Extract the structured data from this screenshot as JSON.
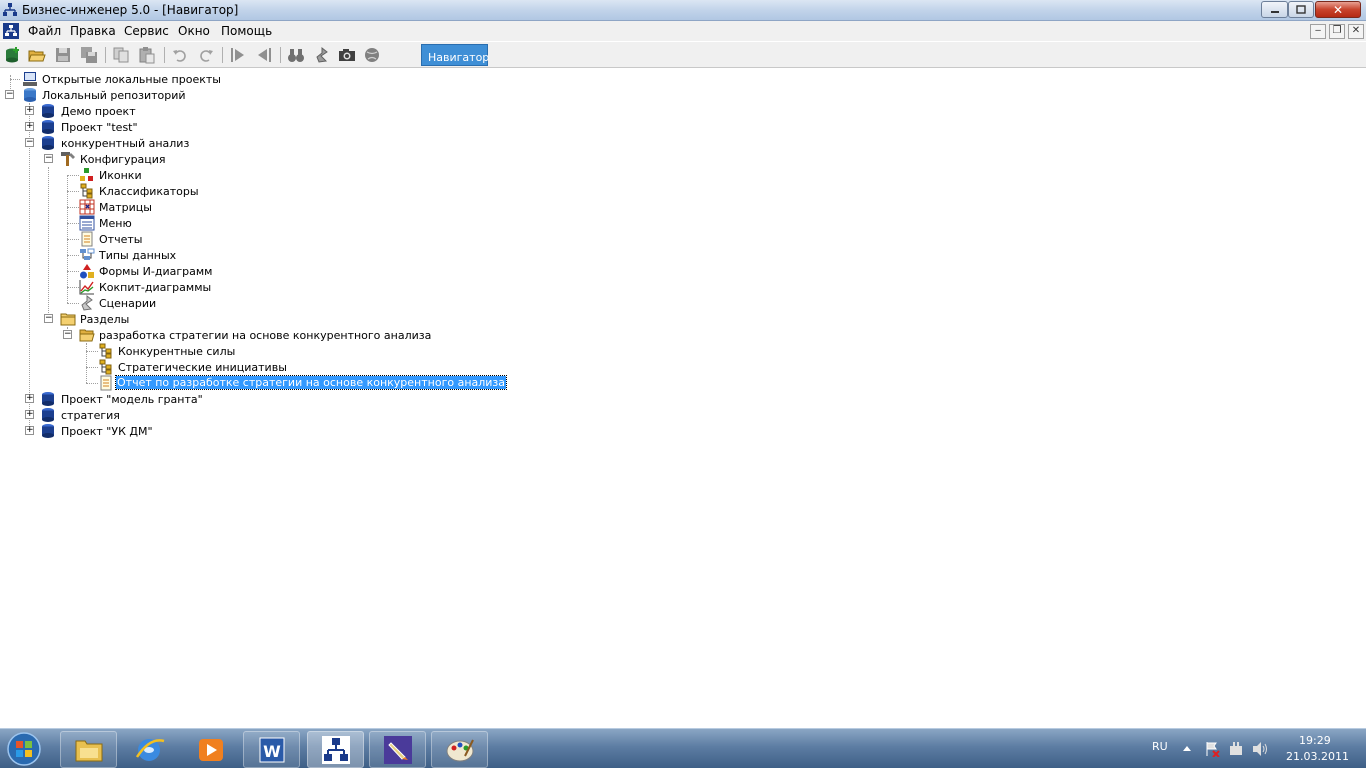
{
  "window": {
    "title": "Бизнес-инженер 5.0 - [Навигатор]",
    "mdi_buttons": [
      "‒",
      "❐",
      "✕"
    ]
  },
  "menu": [
    "Файл",
    "Правка",
    "Сервис",
    "Окно",
    "Помощь"
  ],
  "toolbar": {
    "tab_label": "Навигатор"
  },
  "tree": {
    "open_projects": "Открытые локальные проекты",
    "local_repo": "Локальный репозиторий",
    "demo": "Демо проект",
    "test": "Проект \"test\"",
    "konk": "конкурентный анализ",
    "config": "Конфигурация",
    "icons": "Иконки",
    "classifiers": "Классификаторы",
    "matrices": "Матрицы",
    "menu": "Меню",
    "reports": "Отчеты",
    "datatypes": "Типы данных",
    "forms": "Формы И-диаграмм",
    "cockpit": "Кокпит-диаграммы",
    "scenarios": "Сценарии",
    "sections": "Разделы",
    "strategy_dev": "разработка стратегии на основе конкурентного анализа",
    "forces": "Конкурентные силы",
    "initiatives": "Стратегические инициативы",
    "report": "Отчет по разработке стратегии на основе конкурентного анализа",
    "grant": "Проект \"модель гранта\"",
    "strategy": "стратегия",
    "ukdm": "Проект \"УК ДМ\""
  },
  "taskbar": {
    "lang": "RU",
    "time": "19:29",
    "date": "21.03.2011"
  },
  "colors": {
    "selection": "#3399ff",
    "nav_tab": "#3f8fd6",
    "db_icon": "#1c3f8f"
  }
}
